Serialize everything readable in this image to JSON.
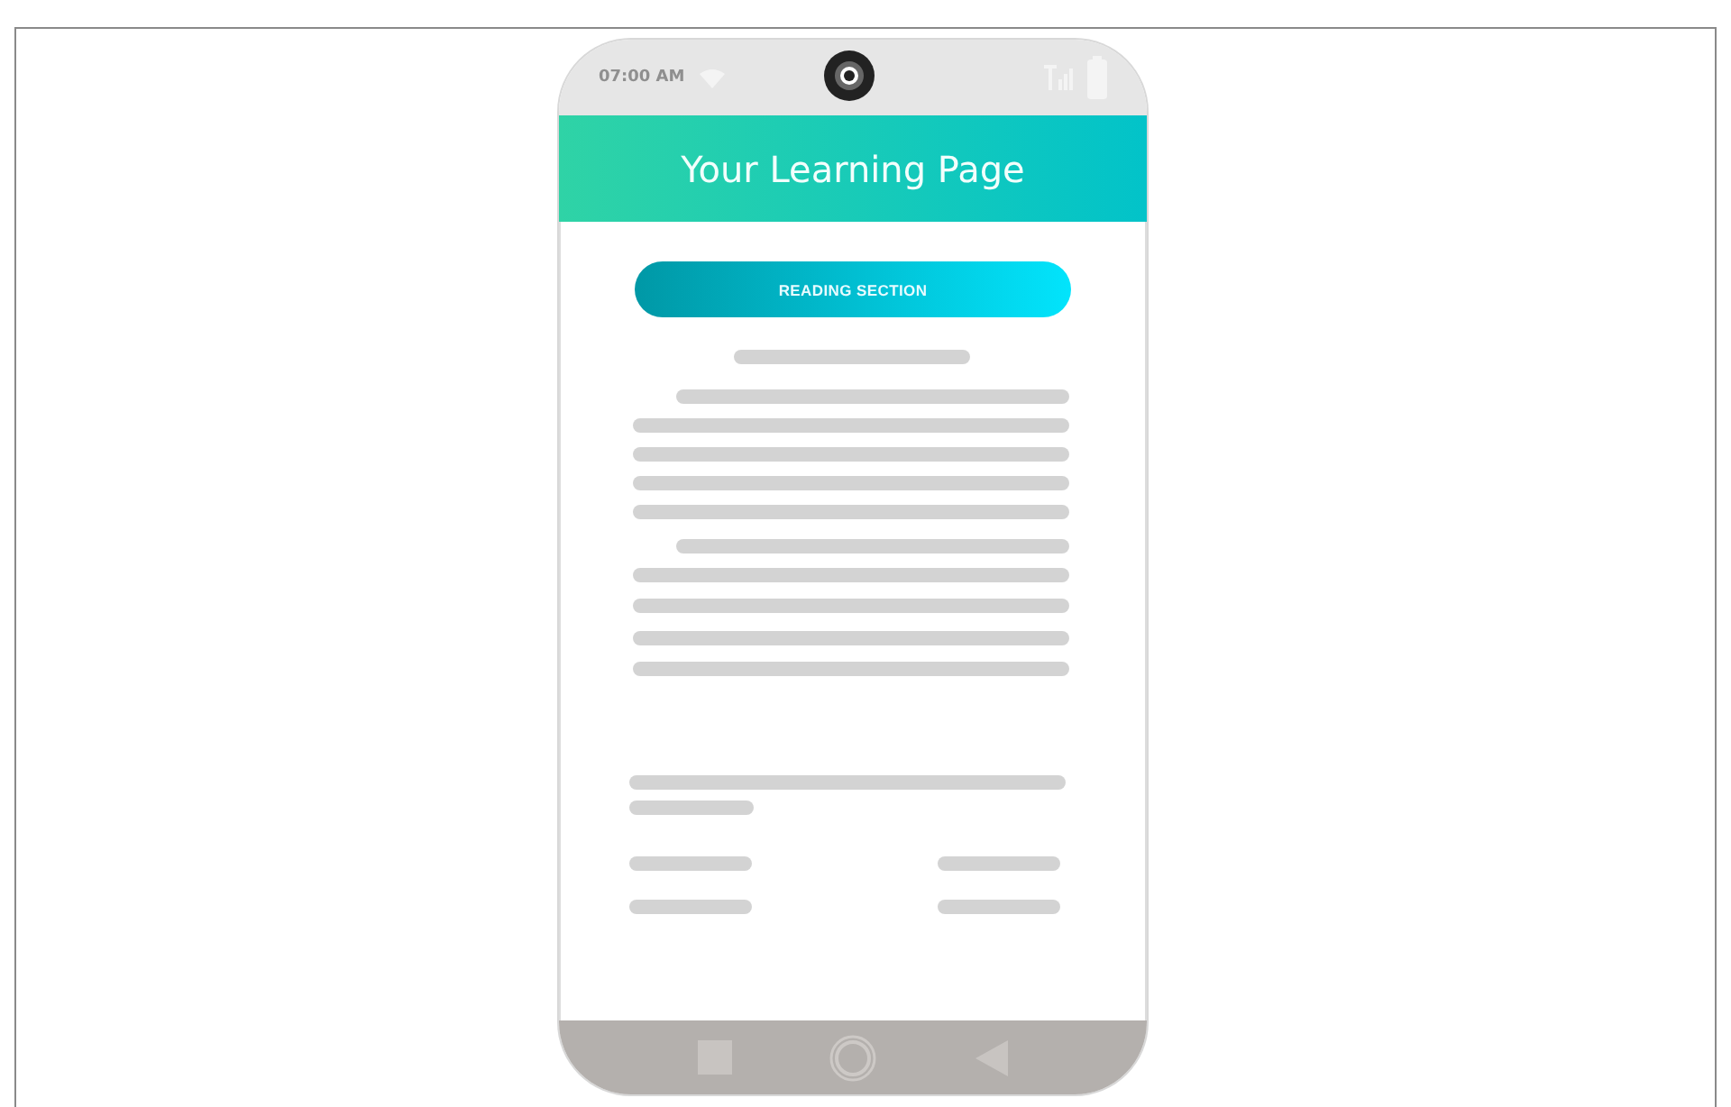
{
  "status_bar": {
    "time": "07:00 AM"
  },
  "header": {
    "title": "Your Learning Page"
  },
  "section_button": {
    "label": "READING SECTION"
  }
}
